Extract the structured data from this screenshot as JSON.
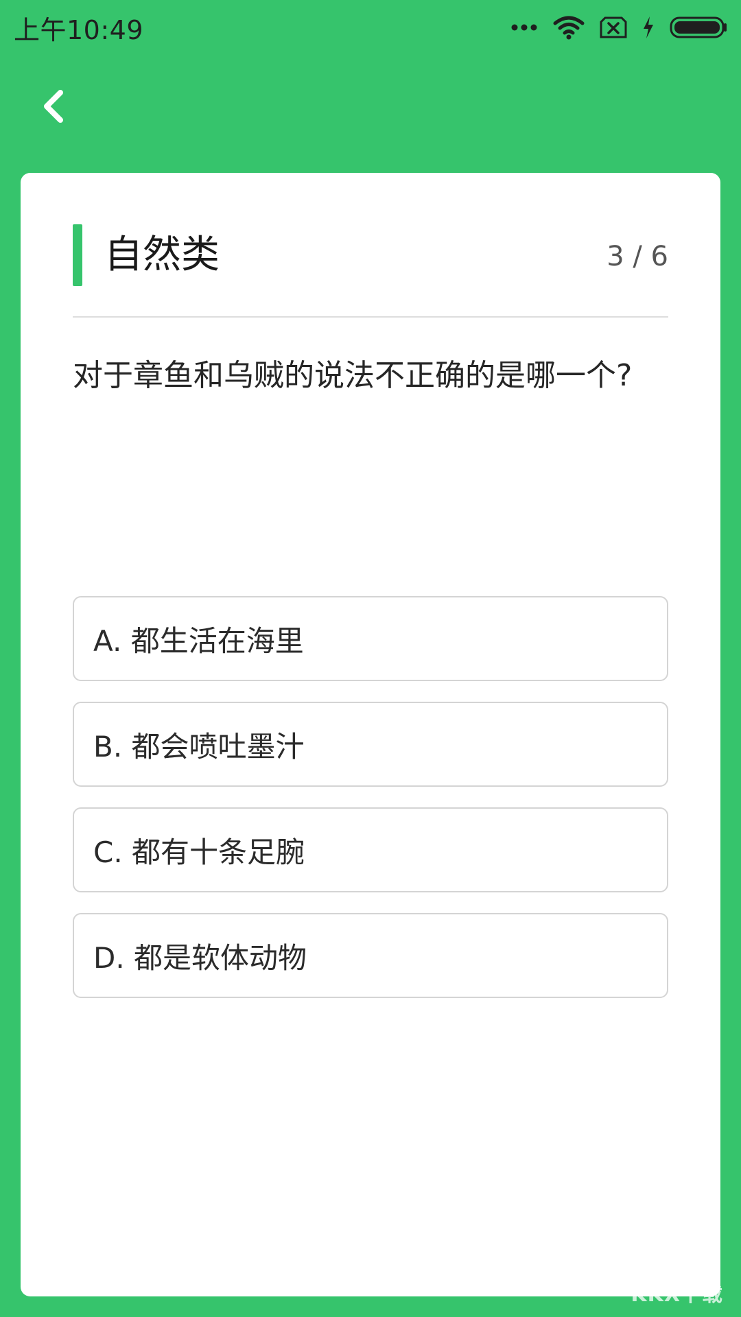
{
  "status_bar": {
    "time": "上午10:49",
    "icons": [
      "dots-icon",
      "wifi-icon",
      "sim-off-icon",
      "charging-icon",
      "battery-icon"
    ]
  },
  "top_bar": {
    "back_icon": "back-chevron-icon"
  },
  "quiz": {
    "category": "自然类",
    "progress": "3 / 6",
    "question": "对于章鱼和乌贼的说法不正确的是哪一个?",
    "options": [
      "A. 都生活在海里",
      "B. 都会喷吐墨汁",
      "C. 都有十条足腕",
      "D. 都是软体动物"
    ]
  },
  "watermark": "KKX下载",
  "colors": {
    "brand_green": "#36c46c",
    "card_bg": "#ffffff",
    "option_border": "#d4d4d4"
  }
}
